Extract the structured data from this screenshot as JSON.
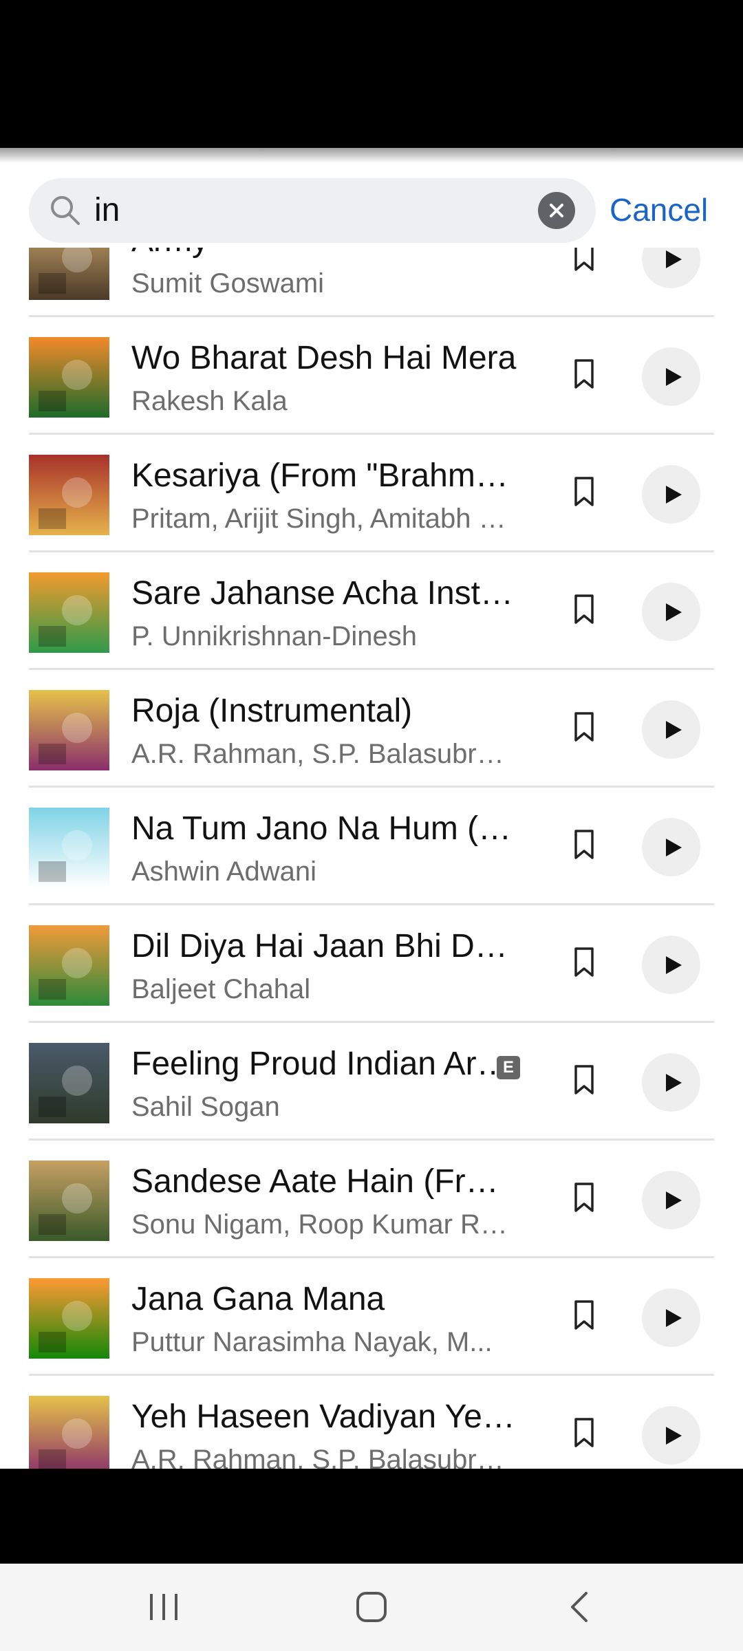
{
  "search": {
    "query": "in",
    "cancel_label": "Cancel"
  },
  "tracks": [
    {
      "title": "Army",
      "artist": "Sumit Goswami",
      "explicit": false,
      "thumb": [
        "#c9a46a",
        "#4b3a28"
      ]
    },
    {
      "title": "Wo Bharat Desh Hai Mera",
      "artist": "Rakesh Kala",
      "explicit": false,
      "thumb": [
        "#f28a2a",
        "#1d6b2a"
      ]
    },
    {
      "title": "Kesariya (From \"Brahmastra\")",
      "artist": "Pritam, Arijit Singh, Amitabh Bhattacharya",
      "explicit": false,
      "thumb": [
        "#a8322a",
        "#e6b24c"
      ]
    },
    {
      "title": "Sare Jahanse Acha Instrumental",
      "artist": "P. Unnikrishnan-Dinesh",
      "explicit": false,
      "thumb": [
        "#f39a2e",
        "#2e9a4a"
      ]
    },
    {
      "title": "Roja (Instrumental)",
      "artist": "A.R. Rahman, S.P. Balasubrahmanyam",
      "explicit": false,
      "thumb": [
        "#e5c24a",
        "#8a2e6b"
      ]
    },
    {
      "title": "Na Tum Jano Na Hum (Cover)",
      "artist": "Ashwin Adwani",
      "explicit": false,
      "thumb": [
        "#7fd3e6",
        "#ffffff"
      ]
    },
    {
      "title": "Dil Diya Hai Jaan Bhi Denge",
      "artist": "Baljeet Chahal",
      "explicit": false,
      "thumb": [
        "#f29a3a",
        "#2d8a3a"
      ]
    },
    {
      "title": "Feeling Proud Indian Army",
      "artist": "Sahil Sogan",
      "explicit": true,
      "thumb": [
        "#4a5a6a",
        "#2f3b2a"
      ]
    },
    {
      "title": "Sandese Aate Hain (From \"Border\")",
      "artist": "Sonu Nigam, Roop Kumar Rathod",
      "explicit": false,
      "thumb": [
        "#c7a063",
        "#3a5a2a"
      ]
    },
    {
      "title": "Jana Gana Mana",
      "artist": "Puttur Narasimha Nayak, M...",
      "explicit": false,
      "thumb": [
        "#ff9933",
        "#138808"
      ]
    },
    {
      "title": "Yeh Haseen Vadiyan Yeh Khula Aasman",
      "artist": "A.R. Rahman, S.P. Balasubrahmanyam",
      "explicit": false,
      "thumb": [
        "#e5c24a",
        "#8a2e6b"
      ]
    }
  ],
  "icons": {
    "search": "search-icon",
    "clear": "clear-icon",
    "save": "bookmark-icon",
    "play": "play-icon",
    "nav_recents": "recents-icon",
    "nav_home": "home-icon",
    "nav_back": "back-icon"
  },
  "colors": {
    "accent": "#1a63c7",
    "explicit_badge": "#666666"
  }
}
